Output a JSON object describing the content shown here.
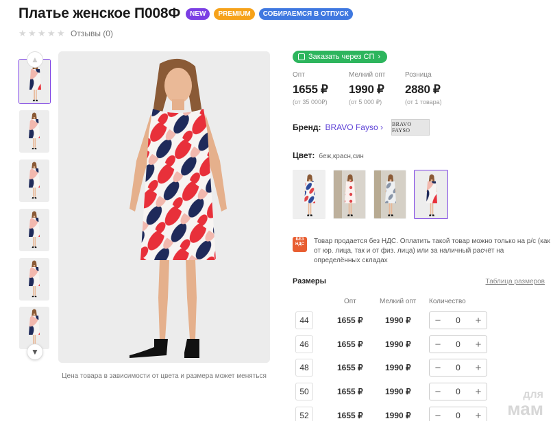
{
  "product": {
    "title": "Платье женское П008Ф",
    "badges": [
      "NEW",
      "PREMIUM",
      "СОБИРАЕМСЯ В ОТПУСК"
    ],
    "reviews_label": "Отзывы (0)",
    "rating": 0,
    "caption": "Цена товара в зависимости от цвета и размера может меняться"
  },
  "order_button": "Заказать через СП",
  "prices": [
    {
      "label": "Опт",
      "value": "1655 ₽",
      "sub": "(от 35 000₽)"
    },
    {
      "label": "Мелкий опт",
      "value": "1990 ₽",
      "sub": "(от 5 000 ₽)"
    },
    {
      "label": "Розница",
      "value": "2880 ₽",
      "sub": "(от 1 товара)"
    }
  ],
  "brand": {
    "label": "Бренд:",
    "name": "BRAVO Fayso",
    "logo_text": "BRAVO FAYSO"
  },
  "color": {
    "label": "Цвет:",
    "value": "беж,красн,син"
  },
  "nds": {
    "icon_text": "БЕЗ НДС",
    "text": "Товар продается без НДС. Оплатить такой товар можно только на р/с (как от юр. лица, так и от физ. лица) или за наличный расчёт на определённых складах"
  },
  "sizes": {
    "title": "Размеры",
    "table_link": "Таблица размеров",
    "headers": {
      "opt": "Опт",
      "small_opt": "Мелкий опт",
      "qty": "Количество"
    },
    "rows": [
      {
        "size": "44",
        "opt": "1655 ₽",
        "small_opt": "1990 ₽",
        "qty": "0"
      },
      {
        "size": "46",
        "opt": "1655 ₽",
        "small_opt": "1990 ₽",
        "qty": "0"
      },
      {
        "size": "48",
        "opt": "1655 ₽",
        "small_opt": "1990 ₽",
        "qty": "0"
      },
      {
        "size": "50",
        "opt": "1655 ₽",
        "small_opt": "1990 ₽",
        "qty": "0"
      },
      {
        "size": "52",
        "opt": "1655 ₽",
        "small_opt": "1990 ₽",
        "qty": "0"
      }
    ]
  },
  "watermark": {
    "line1": "для",
    "line2": "мам"
  },
  "colors": {
    "accent": "#7b3fe4",
    "green": "#2db55d",
    "premium": "#f6a21a",
    "vacation": "#3f78e0",
    "dress_red": "#e8303a",
    "dress_navy": "#1f2a5a",
    "dress_pink": "#f2b8ae"
  }
}
